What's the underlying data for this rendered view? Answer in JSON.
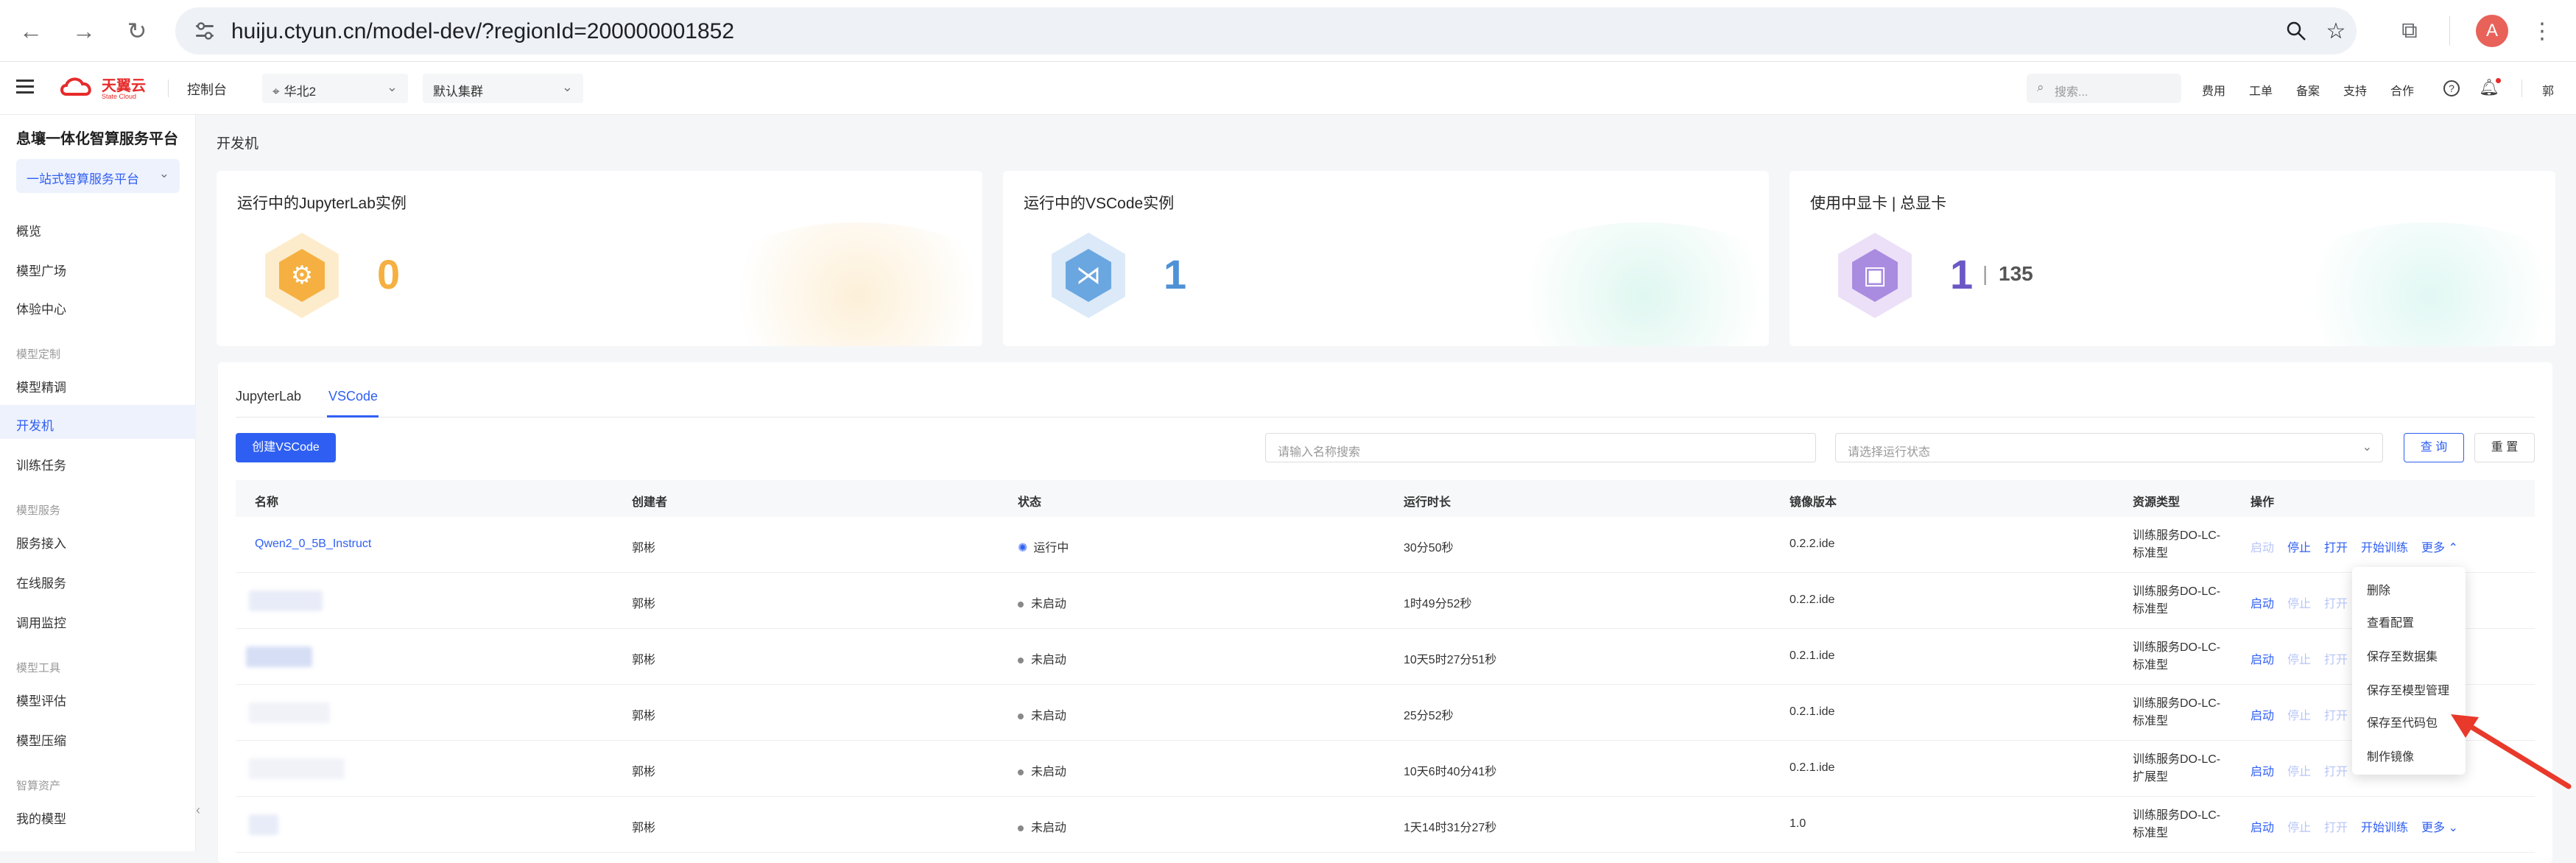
{
  "browser": {
    "url": "huiju.ctyun.cn/model-dev/?regionId=200000001852",
    "avatar": "A"
  },
  "topnav": {
    "brand_cn": "天翼云",
    "brand_en": "State Cloud",
    "console": "控制台",
    "region": "华北2",
    "cluster": "默认集群",
    "search_placeholder": "搜索...",
    "links": [
      "费用",
      "工单",
      "备案",
      "支持",
      "合作"
    ],
    "user": "郭"
  },
  "sidebar": {
    "title": "息壤一体化智算服务平台",
    "platform": "一站式智算服务平台",
    "items": {
      "overview": "概览",
      "model_square": "模型广场",
      "experience": "体验中心",
      "group_custom": "模型定制",
      "finetune": "模型精调",
      "devbox": "开发机",
      "training": "训练任务",
      "group_service": "模型服务",
      "service_access": "服务接入",
      "online_service": "在线服务",
      "monitor": "调用监控",
      "group_tools": "模型工具",
      "eval": "模型评估",
      "compress": "模型压缩",
      "group_assets": "智算资产",
      "my_models": "我的模型"
    }
  },
  "main": {
    "breadcrumb": "开发机",
    "cards": [
      {
        "title": "运行中的JupyterLab实例",
        "value": "0"
      },
      {
        "title": "运行中的VSCode实例",
        "value": "1"
      },
      {
        "title": "使用中显卡 | 总显卡",
        "value": "1",
        "total": "135",
        "sep": "|"
      }
    ],
    "tabs": [
      "JupyterLab",
      "VSCode"
    ],
    "create_btn": "创建VSCode",
    "name_search_placeholder": "请输入名称搜索",
    "status_placeholder": "请选择运行状态",
    "query_btn": "查 询",
    "reset_btn": "重 置",
    "columns": [
      "名称",
      "创建者",
      "状态",
      "运行时长",
      "镜像版本",
      "资源类型",
      "操作"
    ],
    "rows": [
      {
        "name": "Qwen2_0_5B_Instruct",
        "creator": "郭彬",
        "status": "运行中",
        "duration": "30分50秒",
        "image": "0.2.2.ide",
        "res1": "训练服务DO-LC-",
        "res2": "标准型"
      },
      {
        "name": "",
        "creator": "郭彬",
        "status": "未启动",
        "duration": "1时49分52秒",
        "image": "0.2.2.ide",
        "res1": "训练服务DO-LC-",
        "res2": "标准型"
      },
      {
        "name": "",
        "creator": "郭彬",
        "status": "未启动",
        "duration": "10天5时27分51秒",
        "image": "0.2.1.ide",
        "res1": "训练服务DO-LC-",
        "res2": "标准型"
      },
      {
        "name": "",
        "creator": "郭彬",
        "status": "未启动",
        "duration": "25分52秒",
        "image": "0.2.1.ide",
        "res1": "训练服务DO-LC-",
        "res2": "标准型"
      },
      {
        "name": "",
        "creator": "郭彬",
        "status": "未启动",
        "duration": "10天6时40分41秒",
        "image": "0.2.1.ide",
        "res1": "训练服务DO-LC-",
        "res2": "扩展型"
      },
      {
        "name": "",
        "creator": "郭彬",
        "status": "未启动",
        "duration": "1天14时31分27秒",
        "image": "1.0",
        "res1": "训练服务DO-LC-",
        "res2": "标准型"
      }
    ],
    "ops": {
      "start": "启动",
      "stop": "停止",
      "open": "打开",
      "train": "开始训练",
      "more": "更多"
    },
    "dropdown": [
      "删除",
      "查看配置",
      "保存至数据集",
      "保存至模型管理",
      "保存至代码包",
      "制作镜像"
    ]
  },
  "colors": {
    "accent": "#2f5ff2",
    "orange": "#f5b041",
    "green_arrow": "#e8392b"
  }
}
